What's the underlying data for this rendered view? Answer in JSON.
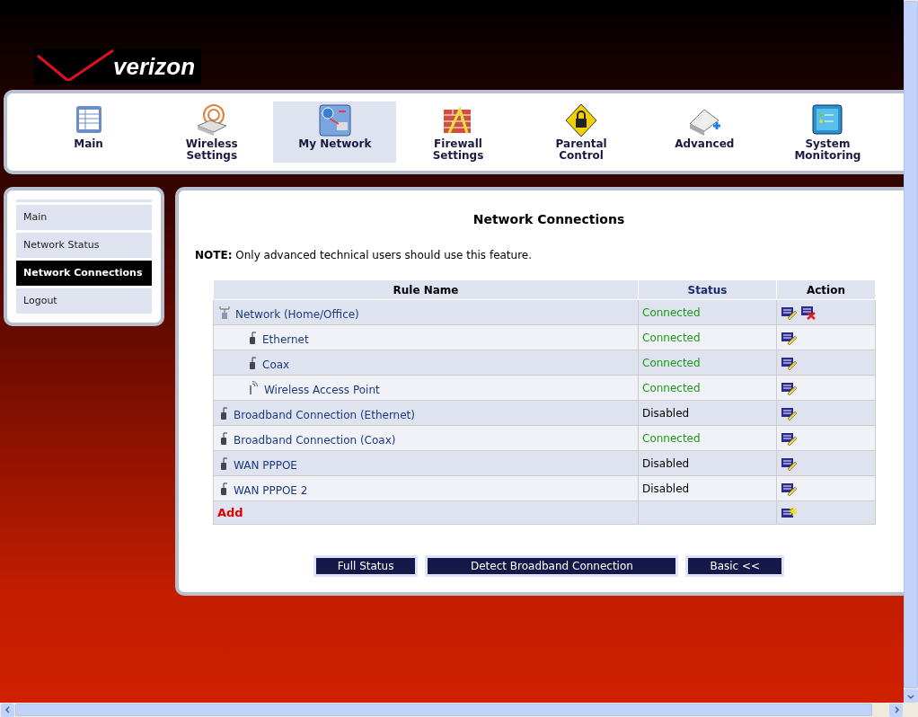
{
  "logo": {
    "text": "verizon"
  },
  "nav": [
    {
      "label": "Main",
      "kind": "main",
      "selected": false
    },
    {
      "label": "Wireless Settings",
      "kind": "wireless",
      "selected": false
    },
    {
      "label": "My Network",
      "kind": "network",
      "selected": true
    },
    {
      "label": "Firewall Settings",
      "kind": "firewall",
      "selected": false
    },
    {
      "label": "Parental Control",
      "kind": "parental",
      "selected": false
    },
    {
      "label": "Advanced",
      "kind": "advanced",
      "selected": false
    },
    {
      "label": "System Monitoring",
      "kind": "monitoring",
      "selected": false
    }
  ],
  "sidebar": {
    "items": [
      {
        "label": "Main",
        "selected": false
      },
      {
        "label": "Network Status",
        "selected": false
      },
      {
        "label": "Network Connections",
        "selected": true
      },
      {
        "label": "Logout",
        "selected": false
      }
    ]
  },
  "content": {
    "title": "Network Connections",
    "note": "**NOTE:** Only advanced technical users should use this feature.",
    "table": {
      "columns": [
        "Rule Name",
        "Status",
        "Action"
      ],
      "rows": [
        {
          "name": "Network (Home/Office)",
          "kind": "bridge",
          "status": "Connected",
          "connected": true,
          "deletable": true,
          "children": [
            {
              "name": "Ethernet",
              "kind": "wired",
              "status": "Connected",
              "connected": true,
              "deletable": false
            },
            {
              "name": "Coax",
              "kind": "wired",
              "status": "Connected",
              "connected": true,
              "deletable": false
            },
            {
              "name": "Wireless Access Point",
              "kind": "wireless",
              "status": "Connected",
              "connected": true,
              "deletable": false
            }
          ]
        },
        {
          "name": "Broadband Connection (Ethernet)",
          "kind": "wired",
          "status": "Disabled",
          "connected": false,
          "deletable": false
        },
        {
          "name": "Broadband Connection (Coax)",
          "kind": "wired",
          "status": "Connected",
          "connected": true,
          "deletable": false
        },
        {
          "name": "WAN PPPOE",
          "kind": "wired",
          "status": "Disabled",
          "connected": false,
          "deletable": false
        },
        {
          "name": "WAN PPPOE 2",
          "kind": "wired",
          "status": "Disabled",
          "connected": false,
          "deletable": false
        }
      ],
      "add_label": "Add"
    },
    "buttons": [
      "Full Status",
      "Detect Broadband Connection",
      "Basic <<"
    ]
  }
}
